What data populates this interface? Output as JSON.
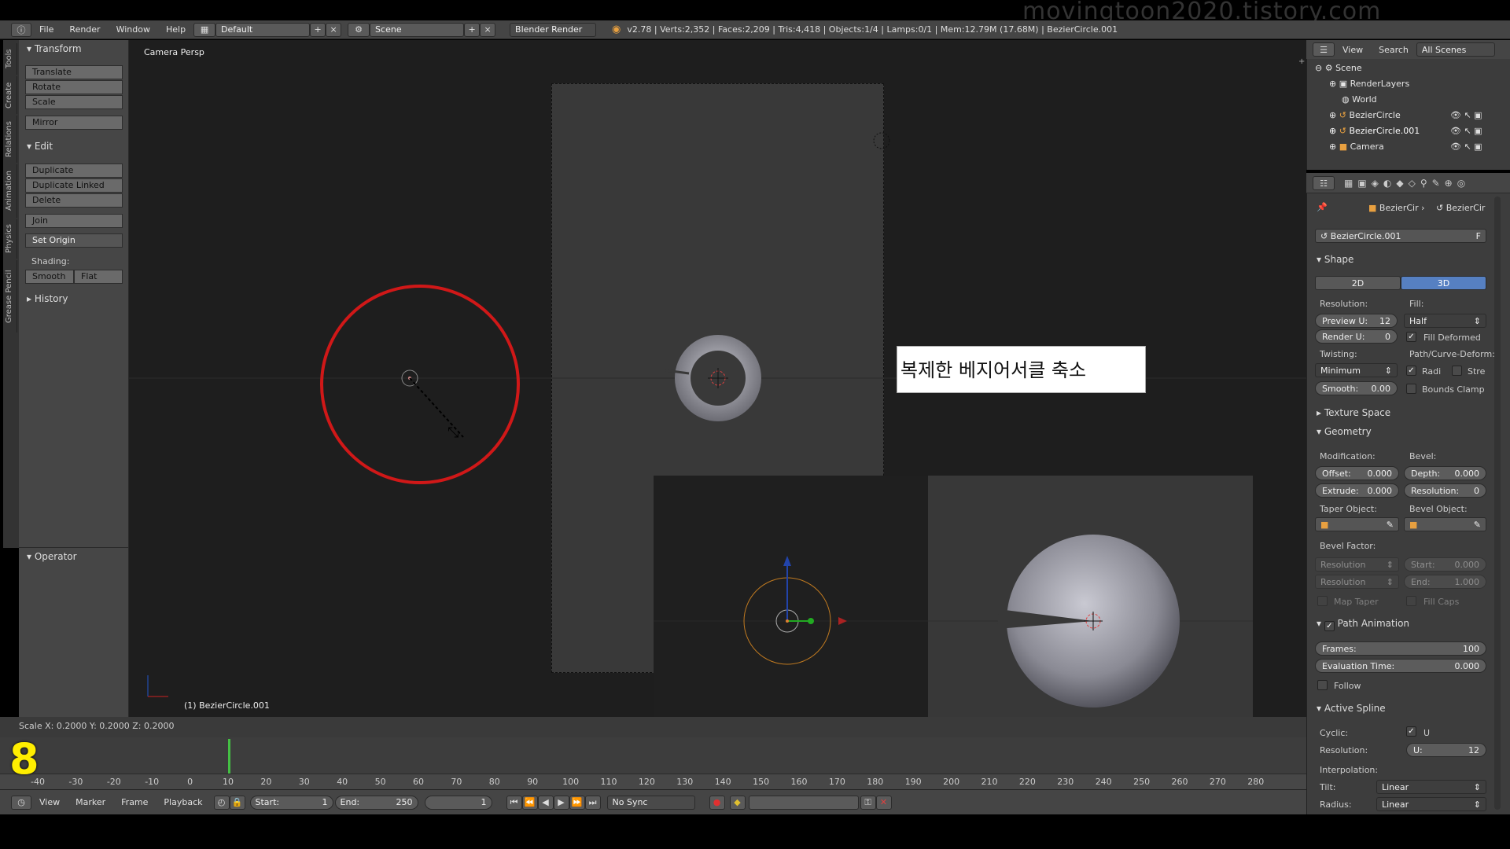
{
  "watermark": "movingtoon2020.tistory.com",
  "menubar": {
    "menus": [
      "File",
      "Render",
      "Window",
      "Help"
    ],
    "layout": "Default",
    "scene": "Scene",
    "engine": "Blender Render",
    "stats": "v2.78 | Verts:2,352 | Faces:2,209 | Tris:4,418 | Objects:1/4 | Lamps:0/1 | Mem:12.79M (17.68M) | BezierCircle.001"
  },
  "vtabs": [
    "Tools",
    "Create",
    "Relations",
    "Animation",
    "Physics",
    "Grease Pencil"
  ],
  "toolshelf": {
    "transform_header": "Transform",
    "translate": "Translate",
    "rotate": "Rotate",
    "scale": "Scale",
    "mirror": "Mirror",
    "edit_header": "Edit",
    "duplicate": "Duplicate",
    "duplicate_linked": "Duplicate Linked",
    "delete": "Delete",
    "join": "Join",
    "set_origin": "Set Origin",
    "shading_label": "Shading:",
    "smooth": "Smooth",
    "flat": "Flat",
    "history_header": "History",
    "operator_header": "Operator"
  },
  "viewport": {
    "view_label": "Camera Persp",
    "object_label": "(1) BezierCircle.001",
    "callout": "복제한 베지어서클 축소",
    "status": "Scale X: 0.2000   Y: 0.2000   Z: 0.2000"
  },
  "timeline": {
    "current_frame_overlay": "8",
    "ticks": [
      "-40",
      "-30",
      "-20",
      "-10",
      "0",
      "10",
      "20",
      "30",
      "40",
      "50",
      "60",
      "70",
      "80",
      "90",
      "100",
      "110",
      "120",
      "130",
      "140",
      "150",
      "160",
      "170",
      "180",
      "190",
      "200",
      "210",
      "220",
      "230",
      "240",
      "250",
      "260",
      "270",
      "280"
    ],
    "menus": [
      "View",
      "Marker",
      "Frame",
      "Playback"
    ],
    "start_label": "Start:",
    "start_value": "1",
    "end_label": "End:",
    "end_value": "250",
    "current_value": "1",
    "sync": "No Sync"
  },
  "outliner": {
    "menus": [
      "View",
      "Search"
    ],
    "filter": "All Scenes",
    "items": [
      "Scene",
      "RenderLayers",
      "World",
      "BezierCircle",
      "BezierCircle.001",
      "Camera"
    ]
  },
  "properties": {
    "breadcrumb1": "BezierCir",
    "breadcrumb2": "BezierCir",
    "datablock": "BezierCircle.001",
    "datablock_flag": "F",
    "shape_header": "Shape",
    "btn_2d": "2D",
    "btn_3d": "3D",
    "resolution_label": "Resolution:",
    "fill_label": "Fill:",
    "preview_u": "Preview U:",
    "preview_u_val": "12",
    "render_u": "Render U:",
    "render_u_val": "0",
    "fill_value": "Half",
    "fill_deformed": "Fill Deformed",
    "twisting_label": "Twisting:",
    "twisting_value": "Minimum",
    "path_curve_label": "Path/Curve-Deform:",
    "radius_chk": "Radi",
    "stretch_chk": "Stre",
    "smooth_label": "Smooth:",
    "smooth_val": "0.00",
    "bounds_clamp": "Bounds Clamp",
    "texture_space": "Texture Space",
    "geometry_header": "Geometry",
    "modification_label": "Modification:",
    "bevel_label": "Bevel:",
    "offset_label": "Offset:",
    "offset_val": "0.000",
    "depth_label": "Depth:",
    "depth_val": "0.000",
    "extrude_label": "Extrude:",
    "extrude_val": "0.000",
    "bres_label": "Resolution:",
    "bres_val": "0",
    "taper_label": "Taper Object:",
    "bevel_obj_label": "Bevel Object:",
    "bevel_factor_label": "Bevel Factor:",
    "bf_res1": "Resolution",
    "bf_res2": "Resolution",
    "bf_start_label": "Start:",
    "bf_start_val": "0.000",
    "bf_end_label": "End:",
    "bf_end_val": "1.000",
    "map_taper": "Map Taper",
    "fill_caps": "Fill Caps",
    "path_anim_header": "Path Animation",
    "frames_label": "Frames:",
    "frames_val": "100",
    "evaltime_label": "Evaluation Time:",
    "evaltime_val": "0.000",
    "follow": "Follow",
    "active_spline_header": "Active Spline",
    "cyclic_label": "Cyclic:",
    "cyclic_u": "U",
    "as_res_label": "Resolution:",
    "as_u_label": "U:",
    "as_u_val": "12",
    "interp_label": "Interpolation:",
    "tilt_label": "Tilt:",
    "tilt_val": "Linear",
    "radius_label": "Radius:",
    "radius_val": "Linear"
  }
}
